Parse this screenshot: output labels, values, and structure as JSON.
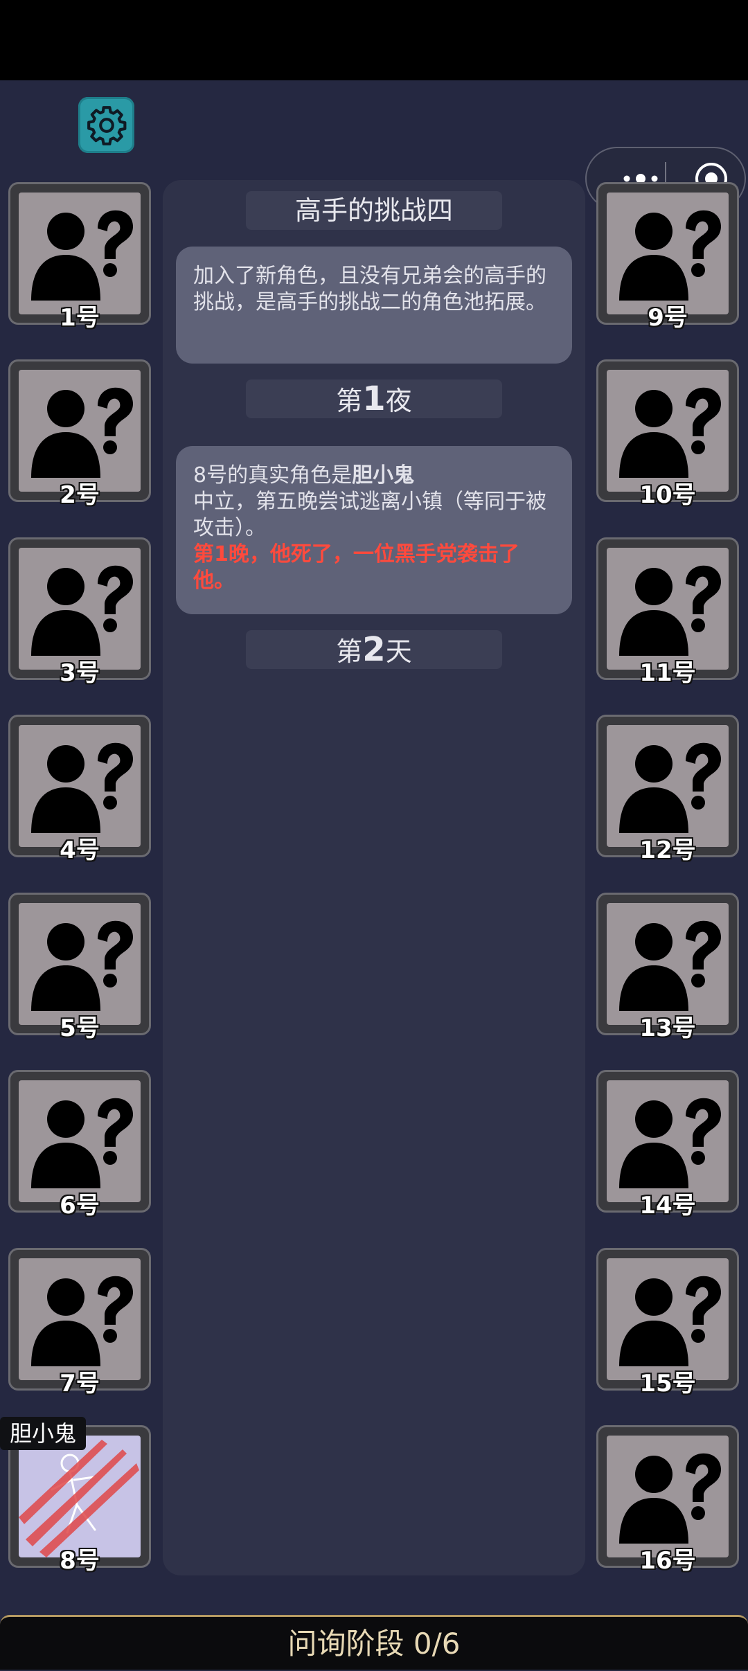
{
  "game": {
    "title": "高手的挑战四",
    "description": "加入了新角色，且没有兄弟会的高手的挑战，是高手的挑战二的角色池拓展。",
    "night1_label": {
      "prefix": "第",
      "num": "1",
      "suffix": "夜"
    },
    "day2_label": {
      "prefix": "第",
      "num": "2",
      "suffix": "天"
    },
    "night1_message": {
      "line1_prefix": "8号的真实角色是",
      "line1_role": "胆小鬼",
      "line2": "中立，第五晚尝试逃离小镇（等同于被攻击）。",
      "death_notice": "第1晚，他死了，一位黑手党袭击了他。"
    },
    "bottom_status": "问询阶段 0/6"
  },
  "players_left": [
    {
      "label": "1号",
      "status": "unknown"
    },
    {
      "label": "2号",
      "status": "unknown"
    },
    {
      "label": "3号",
      "status": "unknown"
    },
    {
      "label": "4号",
      "status": "unknown"
    },
    {
      "label": "5号",
      "status": "unknown"
    },
    {
      "label": "6号",
      "status": "unknown"
    },
    {
      "label": "7号",
      "status": "unknown"
    },
    {
      "label": "8号",
      "status": "dead",
      "role_tag": "胆小鬼"
    }
  ],
  "players_right": [
    {
      "label": "9号",
      "status": "unknown"
    },
    {
      "label": "10号",
      "status": "unknown"
    },
    {
      "label": "11号",
      "status": "unknown"
    },
    {
      "label": "12号",
      "status": "unknown"
    },
    {
      "label": "13号",
      "status": "unknown"
    },
    {
      "label": "14号",
      "status": "unknown"
    },
    {
      "label": "15号",
      "status": "unknown"
    },
    {
      "label": "16号",
      "status": "unknown"
    }
  ],
  "icons": {
    "settings": "gear-icon",
    "more": "more-dots-icon",
    "close": "target-close-icon",
    "unknown_player": "unknown-person-icon"
  },
  "colors": {
    "background": "#252841",
    "panel": "#2f3249",
    "message_bubble": "#5f6278",
    "death_text": "#ff4a3d",
    "settings_accent": "#2a9aa6",
    "bottom_border": "#b59a62"
  }
}
